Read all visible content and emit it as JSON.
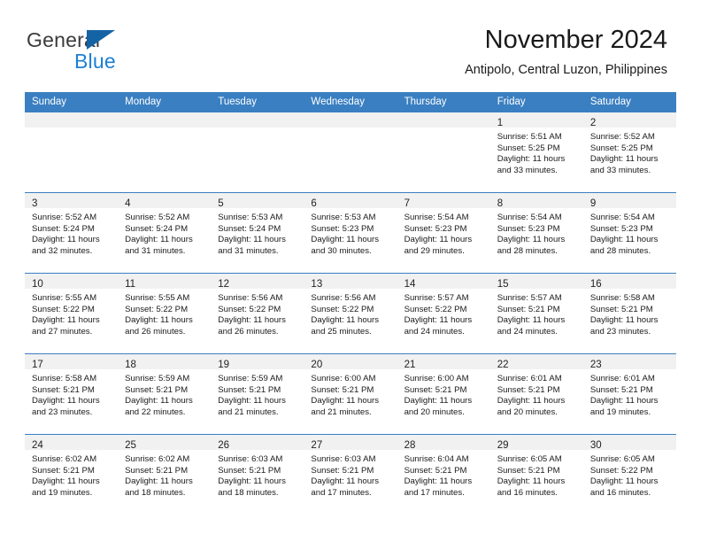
{
  "brand": {
    "name_top": "General",
    "name_bottom": "Blue",
    "accent_color": "#1464a5",
    "text_color": "#3b3b3b"
  },
  "header": {
    "title": "November 2024",
    "subtitle": "Antipolo, Central Luzon, Philippines"
  },
  "calendar": {
    "header_bg": "#3a7fc1",
    "daynum_bg": "#f1f1f1",
    "weekday_headers": [
      "Sunday",
      "Monday",
      "Tuesday",
      "Wednesday",
      "Thursday",
      "Friday",
      "Saturday"
    ],
    "weeks": [
      [
        {
          "day": "",
          "lines": []
        },
        {
          "day": "",
          "lines": []
        },
        {
          "day": "",
          "lines": []
        },
        {
          "day": "",
          "lines": []
        },
        {
          "day": "",
          "lines": []
        },
        {
          "day": "1",
          "lines": [
            "Sunrise: 5:51 AM",
            "Sunset: 5:25 PM",
            "Daylight: 11 hours",
            "and 33 minutes."
          ]
        },
        {
          "day": "2",
          "lines": [
            "Sunrise: 5:52 AM",
            "Sunset: 5:25 PM",
            "Daylight: 11 hours",
            "and 33 minutes."
          ]
        }
      ],
      [
        {
          "day": "3",
          "lines": [
            "Sunrise: 5:52 AM",
            "Sunset: 5:24 PM",
            "Daylight: 11 hours",
            "and 32 minutes."
          ]
        },
        {
          "day": "4",
          "lines": [
            "Sunrise: 5:52 AM",
            "Sunset: 5:24 PM",
            "Daylight: 11 hours",
            "and 31 minutes."
          ]
        },
        {
          "day": "5",
          "lines": [
            "Sunrise: 5:53 AM",
            "Sunset: 5:24 PM",
            "Daylight: 11 hours",
            "and 31 minutes."
          ]
        },
        {
          "day": "6",
          "lines": [
            "Sunrise: 5:53 AM",
            "Sunset: 5:23 PM",
            "Daylight: 11 hours",
            "and 30 minutes."
          ]
        },
        {
          "day": "7",
          "lines": [
            "Sunrise: 5:54 AM",
            "Sunset: 5:23 PM",
            "Daylight: 11 hours",
            "and 29 minutes."
          ]
        },
        {
          "day": "8",
          "lines": [
            "Sunrise: 5:54 AM",
            "Sunset: 5:23 PM",
            "Daylight: 11 hours",
            "and 28 minutes."
          ]
        },
        {
          "day": "9",
          "lines": [
            "Sunrise: 5:54 AM",
            "Sunset: 5:23 PM",
            "Daylight: 11 hours",
            "and 28 minutes."
          ]
        }
      ],
      [
        {
          "day": "10",
          "lines": [
            "Sunrise: 5:55 AM",
            "Sunset: 5:22 PM",
            "Daylight: 11 hours",
            "and 27 minutes."
          ]
        },
        {
          "day": "11",
          "lines": [
            "Sunrise: 5:55 AM",
            "Sunset: 5:22 PM",
            "Daylight: 11 hours",
            "and 26 minutes."
          ]
        },
        {
          "day": "12",
          "lines": [
            "Sunrise: 5:56 AM",
            "Sunset: 5:22 PM",
            "Daylight: 11 hours",
            "and 26 minutes."
          ]
        },
        {
          "day": "13",
          "lines": [
            "Sunrise: 5:56 AM",
            "Sunset: 5:22 PM",
            "Daylight: 11 hours",
            "and 25 minutes."
          ]
        },
        {
          "day": "14",
          "lines": [
            "Sunrise: 5:57 AM",
            "Sunset: 5:22 PM",
            "Daylight: 11 hours",
            "and 24 minutes."
          ]
        },
        {
          "day": "15",
          "lines": [
            "Sunrise: 5:57 AM",
            "Sunset: 5:21 PM",
            "Daylight: 11 hours",
            "and 24 minutes."
          ]
        },
        {
          "day": "16",
          "lines": [
            "Sunrise: 5:58 AM",
            "Sunset: 5:21 PM",
            "Daylight: 11 hours",
            "and 23 minutes."
          ]
        }
      ],
      [
        {
          "day": "17",
          "lines": [
            "Sunrise: 5:58 AM",
            "Sunset: 5:21 PM",
            "Daylight: 11 hours",
            "and 23 minutes."
          ]
        },
        {
          "day": "18",
          "lines": [
            "Sunrise: 5:59 AM",
            "Sunset: 5:21 PM",
            "Daylight: 11 hours",
            "and 22 minutes."
          ]
        },
        {
          "day": "19",
          "lines": [
            "Sunrise: 5:59 AM",
            "Sunset: 5:21 PM",
            "Daylight: 11 hours",
            "and 21 minutes."
          ]
        },
        {
          "day": "20",
          "lines": [
            "Sunrise: 6:00 AM",
            "Sunset: 5:21 PM",
            "Daylight: 11 hours",
            "and 21 minutes."
          ]
        },
        {
          "day": "21",
          "lines": [
            "Sunrise: 6:00 AM",
            "Sunset: 5:21 PM",
            "Daylight: 11 hours",
            "and 20 minutes."
          ]
        },
        {
          "day": "22",
          "lines": [
            "Sunrise: 6:01 AM",
            "Sunset: 5:21 PM",
            "Daylight: 11 hours",
            "and 20 minutes."
          ]
        },
        {
          "day": "23",
          "lines": [
            "Sunrise: 6:01 AM",
            "Sunset: 5:21 PM",
            "Daylight: 11 hours",
            "and 19 minutes."
          ]
        }
      ],
      [
        {
          "day": "24",
          "lines": [
            "Sunrise: 6:02 AM",
            "Sunset: 5:21 PM",
            "Daylight: 11 hours",
            "and 19 minutes."
          ]
        },
        {
          "day": "25",
          "lines": [
            "Sunrise: 6:02 AM",
            "Sunset: 5:21 PM",
            "Daylight: 11 hours",
            "and 18 minutes."
          ]
        },
        {
          "day": "26",
          "lines": [
            "Sunrise: 6:03 AM",
            "Sunset: 5:21 PM",
            "Daylight: 11 hours",
            "and 18 minutes."
          ]
        },
        {
          "day": "27",
          "lines": [
            "Sunrise: 6:03 AM",
            "Sunset: 5:21 PM",
            "Daylight: 11 hours",
            "and 17 minutes."
          ]
        },
        {
          "day": "28",
          "lines": [
            "Sunrise: 6:04 AM",
            "Sunset: 5:21 PM",
            "Daylight: 11 hours",
            "and 17 minutes."
          ]
        },
        {
          "day": "29",
          "lines": [
            "Sunrise: 6:05 AM",
            "Sunset: 5:21 PM",
            "Daylight: 11 hours",
            "and 16 minutes."
          ]
        },
        {
          "day": "30",
          "lines": [
            "Sunrise: 6:05 AM",
            "Sunset: 5:22 PM",
            "Daylight: 11 hours",
            "and 16 minutes."
          ]
        }
      ]
    ]
  }
}
